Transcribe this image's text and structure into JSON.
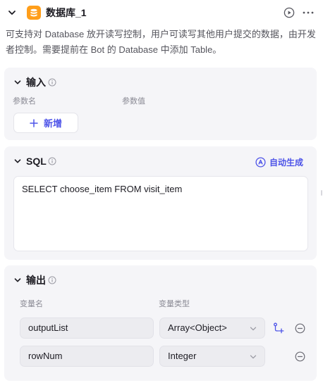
{
  "header": {
    "title": "数据库_1",
    "icons": {
      "collapse": "chevron-down-icon",
      "node": "database-icon",
      "run": "play-circle-icon",
      "more": "more-horizontal-icon"
    }
  },
  "description": "可支持对 Database 放开读写控制，用户可读写其他用户提交的数据，由开发者控制。需要提前在 Bot 的 Database 中添加 Table。",
  "input_section": {
    "title": "输入",
    "columns": [
      "参数名",
      "参数值"
    ],
    "add_label": "新增"
  },
  "sql_section": {
    "title": "SQL",
    "auto_generate_label": "自动生成",
    "query": "SELECT choose_item FROM visit_item"
  },
  "output_section": {
    "title": "输出",
    "columns": [
      "变量名",
      "变量类型"
    ],
    "rows": [
      {
        "name": "outputList",
        "type": "Array<Object>"
      },
      {
        "name": "rowNum",
        "type": "Integer"
      }
    ]
  },
  "colors": {
    "accent": "#4d53e8",
    "node_icon": "#ff9e1a",
    "card_bg": "#f5f5f8",
    "muted_text": "#8a8a94"
  }
}
